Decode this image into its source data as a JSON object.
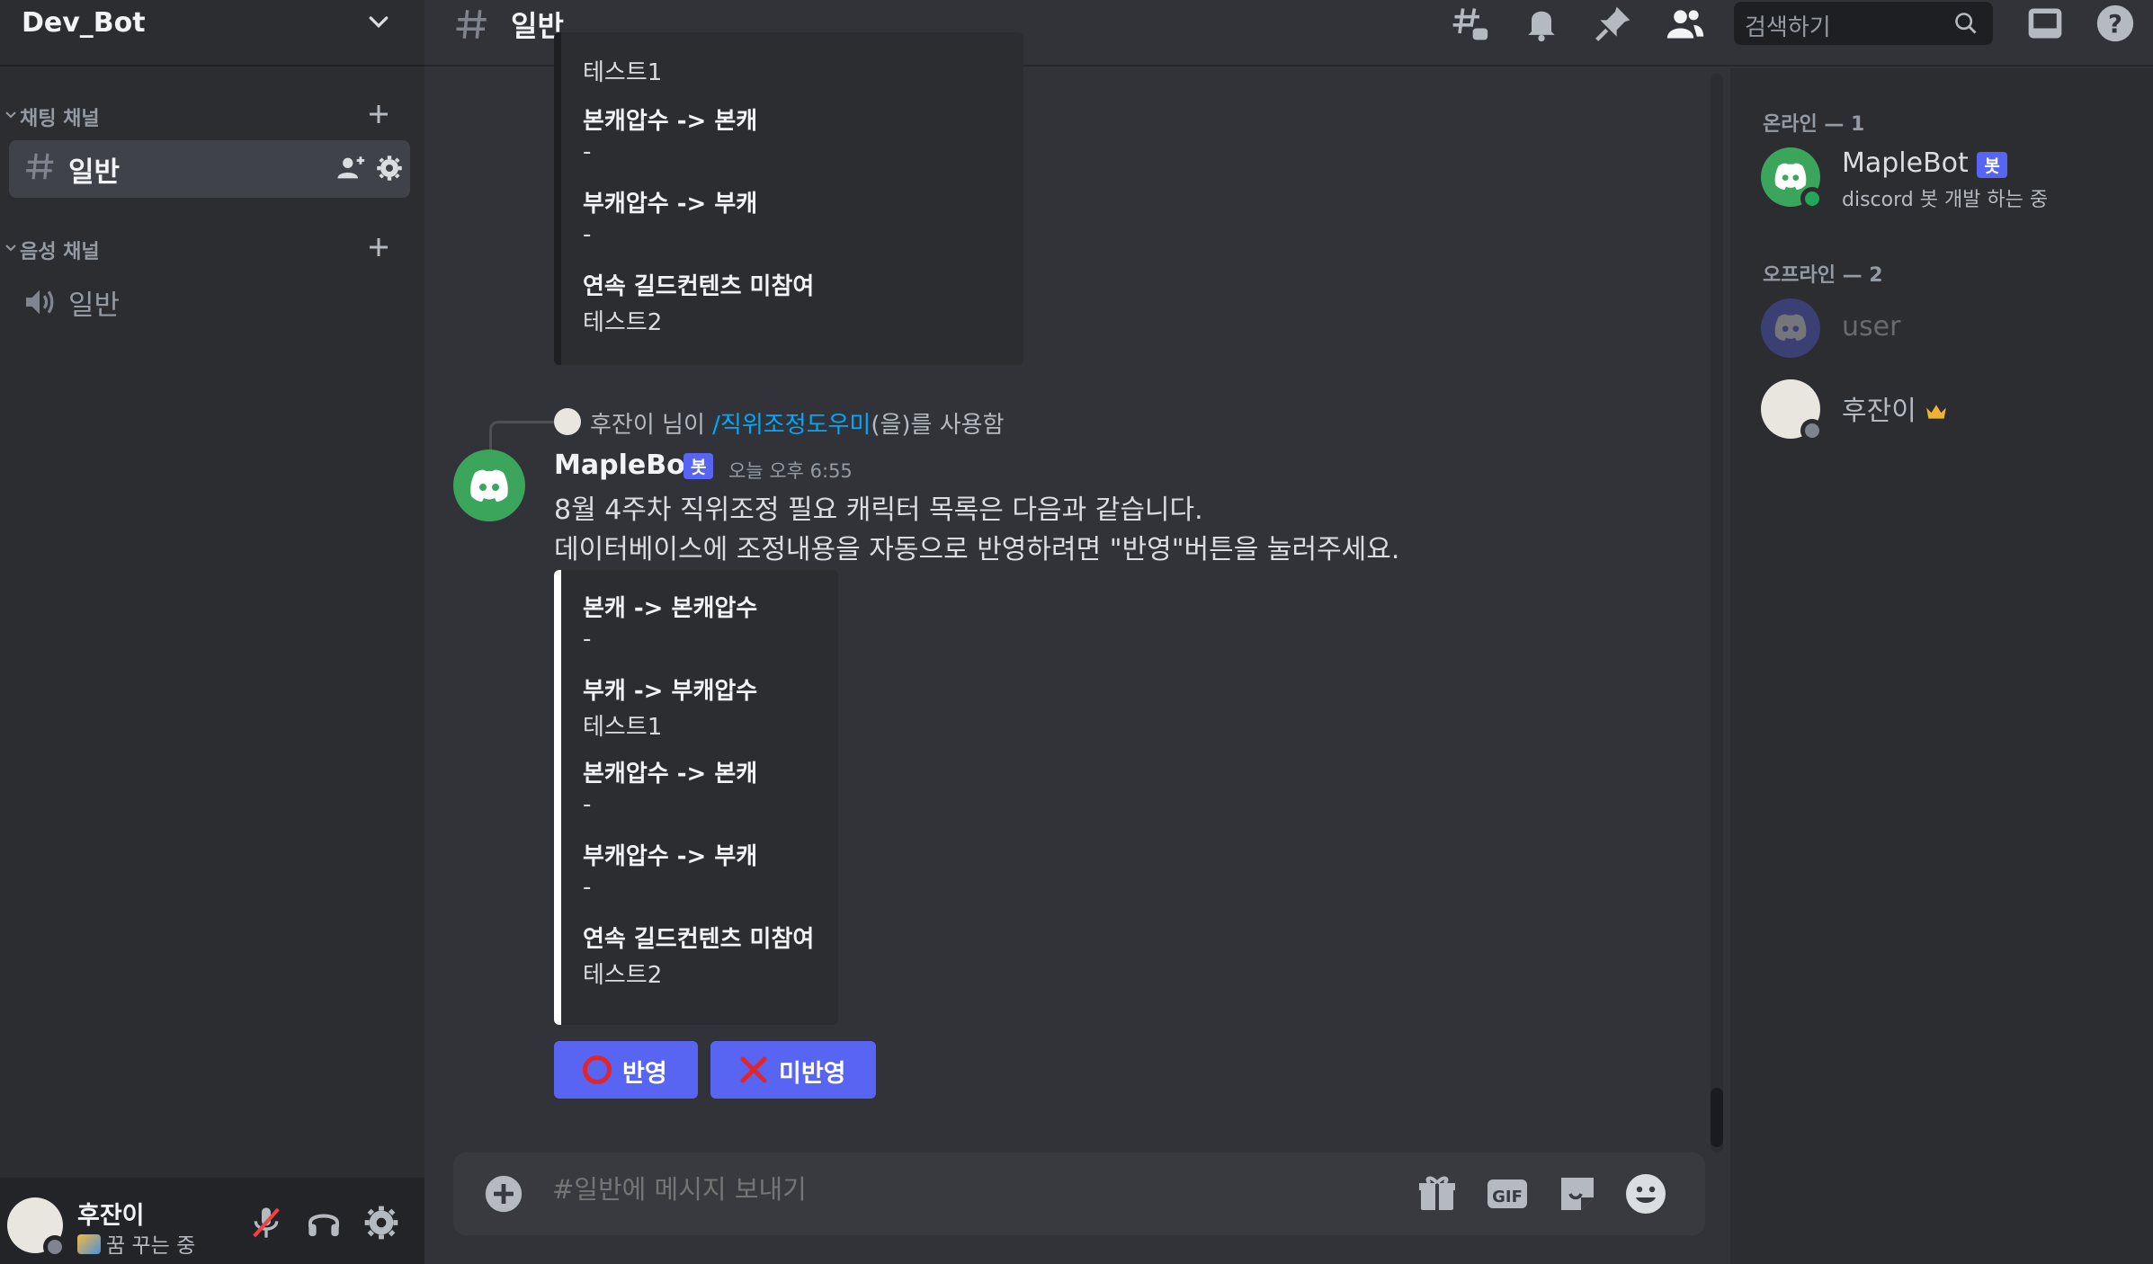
{
  "server": {
    "name": "Dev_Bot"
  },
  "categories": {
    "text": "채팅 채널",
    "voice": "음성 채널"
  },
  "channels": {
    "text_active": "일반",
    "voice": "일반"
  },
  "user": {
    "name": "후잔이",
    "status": "꿈 꾸는 중"
  },
  "topbar": {
    "channel": "일반",
    "search_placeholder": "검색하기"
  },
  "embed_top": {
    "fields": [
      {
        "name": "",
        "value": "테스트1"
      },
      {
        "name": "본캐압수 -> 본캐",
        "value": "-"
      },
      {
        "name": "부캐압수 -> 부캐",
        "value": "-"
      },
      {
        "name": "연속 길드컨텐츠 미참여",
        "value": "테스트2"
      }
    ]
  },
  "reply": {
    "user": "후잔이 님이",
    "command": "/직위조정도우미",
    "suffix": "(을)를 사용함"
  },
  "message": {
    "author": "MapleBot",
    "bot_tag": "봇",
    "time": "오늘 오후 6:55",
    "line1": "8월 4주차 직위조정 필요 캐릭터 목록은 다음과 같습니다.",
    "line2": "데이터베이스에 조정내용을 자동으로 반영하려면 \"반영\"버튼을 눌러주세요."
  },
  "embed_main": {
    "fields": [
      {
        "name": "본캐 -> 본캐압수",
        "value": "-"
      },
      {
        "name": "부캐 -> 부캐압수",
        "value": "테스트1"
      },
      {
        "name": "본캐압수 -> 본캐",
        "value": "-"
      },
      {
        "name": "부캐압수 -> 부캐",
        "value": "-"
      },
      {
        "name": "연속 길드컨텐츠 미참여",
        "value": "테스트2"
      }
    ]
  },
  "buttons": {
    "apply": "반영",
    "reject": "미반영"
  },
  "composer": {
    "placeholder": "#일반에 메시지 보내기"
  },
  "members": {
    "online_header": "온라인 — 1",
    "offline_header": "오프라인 — 2",
    "online": [
      {
        "name": "MapleBot",
        "tag": "봇",
        "activity": "discord 봇 개발 하는 중"
      }
    ],
    "offline": [
      {
        "name": "user"
      },
      {
        "name": "후잔이"
      }
    ]
  },
  "colors": {
    "accent": "#5865f2",
    "online": "#23a55a",
    "bot_avatar": "#3ba55c",
    "embed_bar_main": "#ffffff",
    "embed_bar_top": "#1e1f22"
  },
  "icons": [
    "chevron-down-icon",
    "plus-icon",
    "hash-icon",
    "add-member-icon",
    "gear-icon",
    "speaker-icon",
    "mic-muted-icon",
    "headphones-icon",
    "threads-icon",
    "bell-icon",
    "pin-icon",
    "members-icon",
    "search-icon",
    "inbox-icon",
    "help-icon",
    "plus-circle-icon",
    "gift-icon",
    "gif-icon",
    "sticker-icon",
    "emoji-icon",
    "crown-icon",
    "o-mark-icon",
    "x-mark-icon",
    "discord-logo-icon"
  ]
}
